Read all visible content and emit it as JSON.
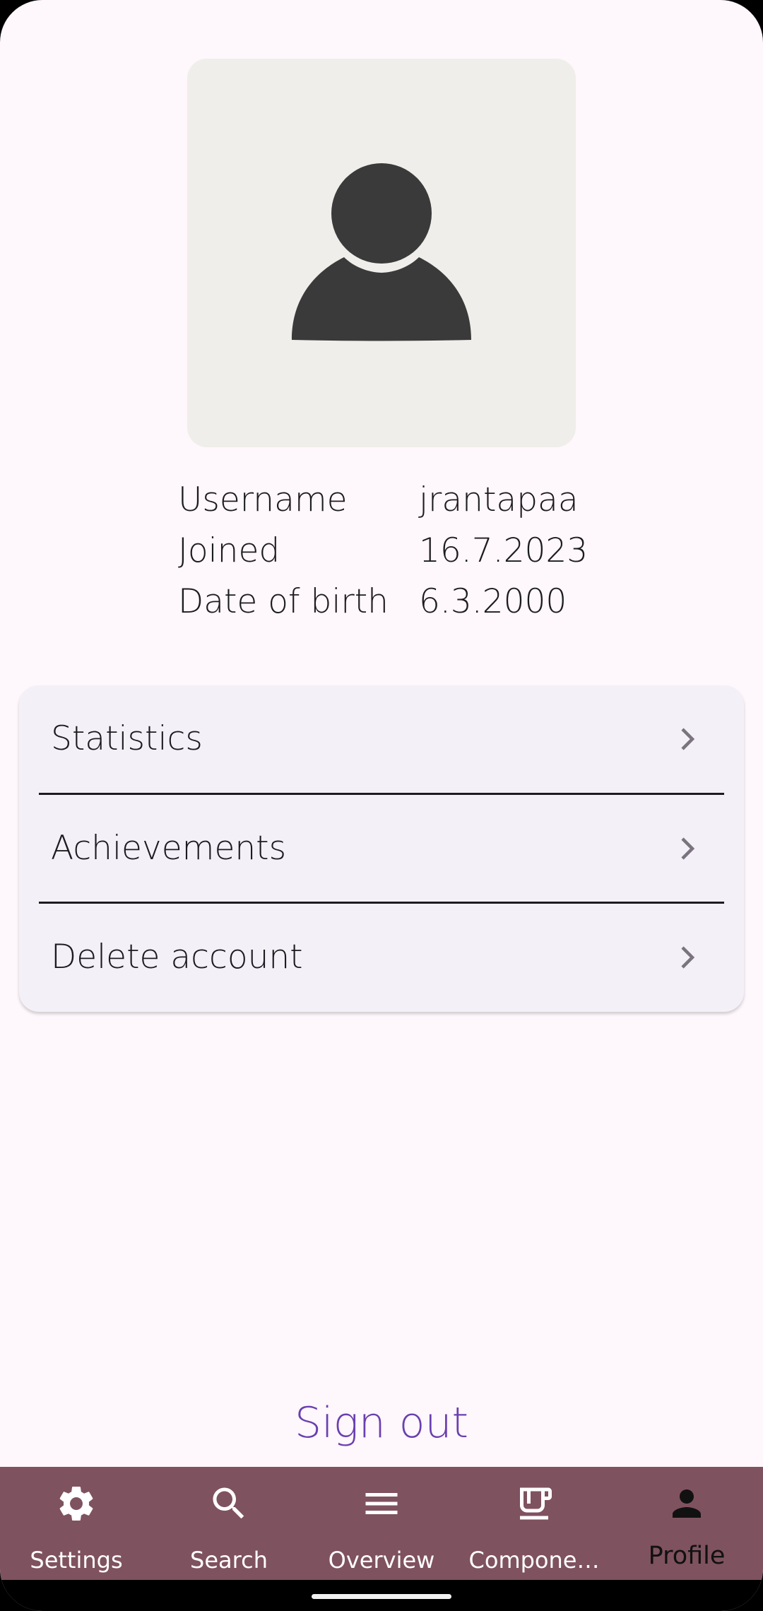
{
  "profile": {
    "rows": [
      {
        "label": "Username",
        "value": "jrantapaa"
      },
      {
        "label": "Joined",
        "value": "16.7.2023"
      },
      {
        "label": "Date of birth",
        "value": "6.3.2000"
      }
    ]
  },
  "menu": {
    "items": [
      {
        "label": "Statistics"
      },
      {
        "label": "Achievements"
      },
      {
        "label": "Delete account"
      }
    ]
  },
  "sign_out_label": "Sign out",
  "nav": {
    "items": [
      {
        "label": "Settings",
        "icon": "gear-icon"
      },
      {
        "label": "Search",
        "icon": "search-icon"
      },
      {
        "label": "Overview",
        "icon": "menu-icon"
      },
      {
        "label": "Compone…",
        "icon": "coffee-cup-icon"
      },
      {
        "label": "Profile",
        "icon": "person-icon",
        "active": true
      }
    ]
  },
  "colors": {
    "background": "#fef7fb",
    "card": "#f4f0f8",
    "nav_bar": "#7f525f",
    "accent": "#6a3fb0",
    "avatar_bg": "#efeeea",
    "avatar_fg": "#3a3a3a"
  }
}
